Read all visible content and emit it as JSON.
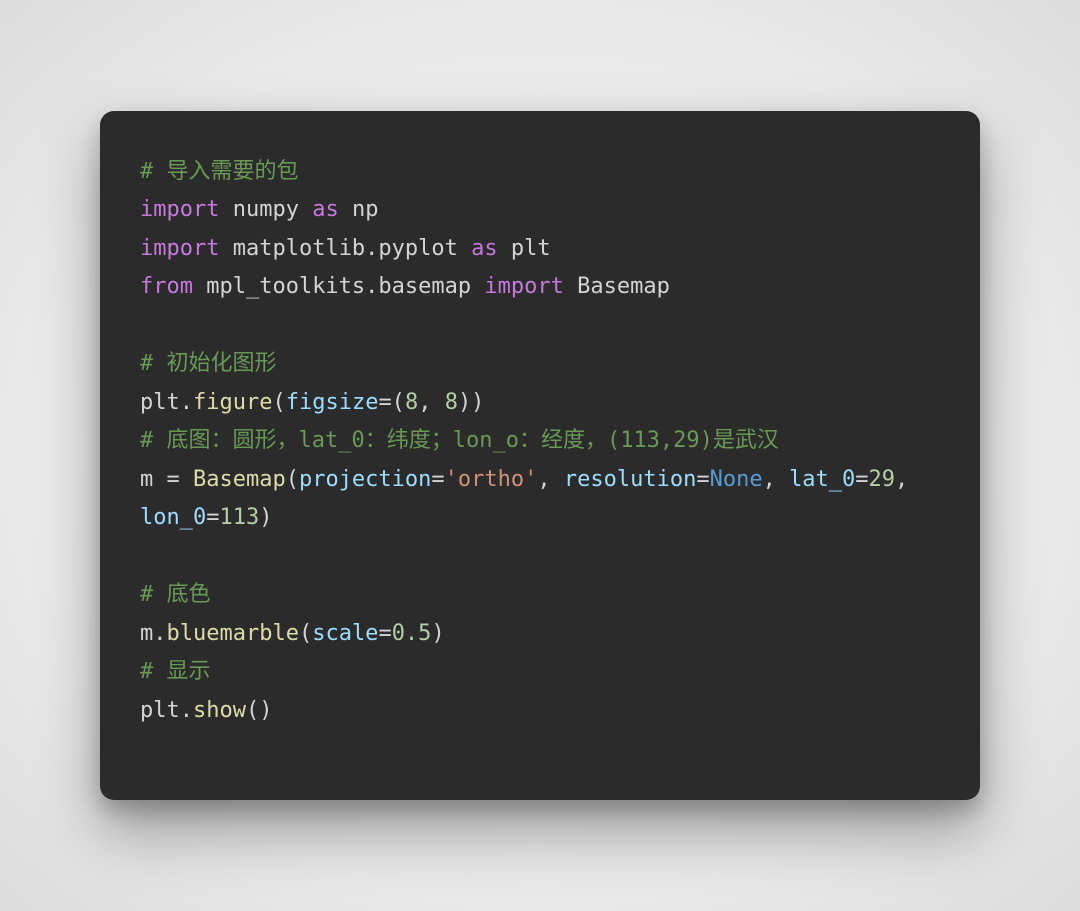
{
  "code": {
    "tokens": [
      {
        "cls": "c-comment",
        "text": "# 导入需要的包"
      },
      {
        "cls": "nl",
        "text": "\n"
      },
      {
        "cls": "c-keyword",
        "text": "import"
      },
      {
        "cls": "c-default",
        "text": " numpy "
      },
      {
        "cls": "c-keyword",
        "text": "as"
      },
      {
        "cls": "c-default",
        "text": " np"
      },
      {
        "cls": "nl",
        "text": "\n"
      },
      {
        "cls": "c-keyword",
        "text": "import"
      },
      {
        "cls": "c-default",
        "text": " matplotlib.pyplot "
      },
      {
        "cls": "c-keyword",
        "text": "as"
      },
      {
        "cls": "c-default",
        "text": " plt"
      },
      {
        "cls": "nl",
        "text": "\n"
      },
      {
        "cls": "c-keyword",
        "text": "from"
      },
      {
        "cls": "c-default",
        "text": " mpl_toolkits.basemap "
      },
      {
        "cls": "c-keyword",
        "text": "import"
      },
      {
        "cls": "c-default",
        "text": " Basemap"
      },
      {
        "cls": "nl",
        "text": "\n"
      },
      {
        "cls": "nl",
        "text": "\n"
      },
      {
        "cls": "c-comment",
        "text": "# 初始化图形"
      },
      {
        "cls": "nl",
        "text": "\n"
      },
      {
        "cls": "c-default",
        "text": "plt."
      },
      {
        "cls": "c-func",
        "text": "figure"
      },
      {
        "cls": "c-default",
        "text": "("
      },
      {
        "cls": "c-param",
        "text": "figsize"
      },
      {
        "cls": "c-default",
        "text": "=("
      },
      {
        "cls": "c-num",
        "text": "8"
      },
      {
        "cls": "c-default",
        "text": ", "
      },
      {
        "cls": "c-num",
        "text": "8"
      },
      {
        "cls": "c-default",
        "text": "))"
      },
      {
        "cls": "nl",
        "text": "\n"
      },
      {
        "cls": "c-comment",
        "text": "# 底图：圆形，lat_0：纬度；lon_o：经度，(113,29)是武汉"
      },
      {
        "cls": "nl",
        "text": "\n"
      },
      {
        "cls": "c-default",
        "text": "m = "
      },
      {
        "cls": "c-func",
        "text": "Basemap"
      },
      {
        "cls": "c-default",
        "text": "("
      },
      {
        "cls": "c-param",
        "text": "projection"
      },
      {
        "cls": "c-default",
        "text": "="
      },
      {
        "cls": "c-str",
        "text": "'ortho'"
      },
      {
        "cls": "c-default",
        "text": ", "
      },
      {
        "cls": "c-param",
        "text": "resolution"
      },
      {
        "cls": "c-default",
        "text": "="
      },
      {
        "cls": "c-const",
        "text": "None"
      },
      {
        "cls": "c-default",
        "text": ", "
      },
      {
        "cls": "c-param",
        "text": "lat_0"
      },
      {
        "cls": "c-default",
        "text": "="
      },
      {
        "cls": "c-num",
        "text": "29"
      },
      {
        "cls": "c-default",
        "text": ", "
      },
      {
        "cls": "c-param",
        "text": "lon_0"
      },
      {
        "cls": "c-default",
        "text": "="
      },
      {
        "cls": "c-num",
        "text": "113"
      },
      {
        "cls": "c-default",
        "text": ")"
      },
      {
        "cls": "nl",
        "text": "\n"
      },
      {
        "cls": "nl",
        "text": "\n"
      },
      {
        "cls": "c-comment",
        "text": "# 底色"
      },
      {
        "cls": "nl",
        "text": "\n"
      },
      {
        "cls": "c-default",
        "text": "m."
      },
      {
        "cls": "c-func",
        "text": "bluemarble"
      },
      {
        "cls": "c-default",
        "text": "("
      },
      {
        "cls": "c-param",
        "text": "scale"
      },
      {
        "cls": "c-default",
        "text": "="
      },
      {
        "cls": "c-num",
        "text": "0.5"
      },
      {
        "cls": "c-default",
        "text": ")"
      },
      {
        "cls": "nl",
        "text": "\n"
      },
      {
        "cls": "c-comment",
        "text": "# 显示"
      },
      {
        "cls": "nl",
        "text": "\n"
      },
      {
        "cls": "c-default",
        "text": "plt."
      },
      {
        "cls": "c-func",
        "text": "show"
      },
      {
        "cls": "c-default",
        "text": "()"
      }
    ]
  }
}
